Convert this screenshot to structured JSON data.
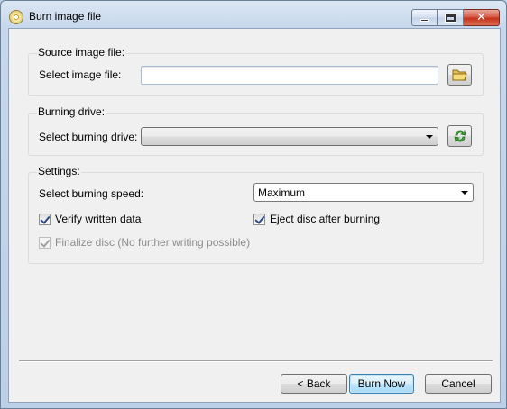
{
  "window": {
    "title": "Burn image file"
  },
  "source": {
    "group_title": "Source image file:",
    "label": "Select image file:",
    "value": ""
  },
  "drive": {
    "group_title": "Burning drive:",
    "label": "Select burning drive:",
    "value": ""
  },
  "settings": {
    "group_title": "Settings:",
    "speed_label": "Select burning speed:",
    "speed_value": "Maximum",
    "verify_label": "Verify written data",
    "verify_checked": true,
    "eject_label": "Eject disc after burning",
    "eject_checked": true,
    "finalize_label": "Finalize disc (No further writing possible)",
    "finalize_checked": true,
    "finalize_disabled": true
  },
  "footer": {
    "back_label": "< Back",
    "burn_label": "Burn Now",
    "cancel_label": "Cancel"
  },
  "icons": {
    "app": "disc-icon",
    "browse": "folder-icon",
    "refresh": "refresh-icon"
  },
  "colors": {
    "title_bar": "#c7d8ec",
    "close_button": "#c42f16",
    "dialog_bg": "#f0f0f0",
    "default_button_border": "#3c7fb1"
  }
}
